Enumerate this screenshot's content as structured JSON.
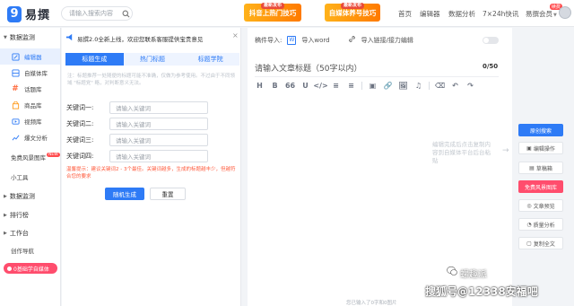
{
  "app": {
    "logo_mark": "9",
    "logo_text": "易撰"
  },
  "header": {
    "search_placeholder": "请输入搜索内容",
    "promo1": {
      "tag": "最新发布",
      "label": "抖音上热门技巧"
    },
    "promo2": {
      "tag": "最新发布",
      "label": "自媒体养号技巧"
    },
    "nav": [
      "首页",
      "编辑器",
      "数据分析",
      "7×24h快讯",
      "易撰会员"
    ],
    "nav_dropdown_marker": "▼",
    "nav_badge": "续费"
  },
  "sidebar": {
    "group_data_monitor": "数据监测",
    "items": [
      {
        "label": "编辑器",
        "icon": "edit-icon",
        "active": true
      },
      {
        "label": "自媒体库",
        "icon": "media-library-icon"
      },
      {
        "label": "话题库",
        "icon": "hashtag-icon"
      },
      {
        "label": "商品库",
        "icon": "shop-icon"
      },
      {
        "label": "视频库",
        "icon": "video-icon"
      },
      {
        "label": "爆文分析",
        "icon": "chart-icon"
      }
    ],
    "free_images": "免费风景图库",
    "free_badge": "NEW",
    "tools": "小工具",
    "group_monitor": "数据监测",
    "group_rank": "排行榜",
    "group_workbench": "工作台",
    "creator_nav": "创作导航",
    "pill": "0基础学自媒体"
  },
  "panel": {
    "notice": "易撰2.0全新上线，欢迎您联系客服提供宝贵意见",
    "notice_close": "×",
    "tabs": [
      "标题生成",
      "热门标题",
      "标题学院"
    ],
    "hint": "注：标题推荐一处随便的标题可能不准确，仅做为参考使用。不过由于不同领域 \"标题党\" 略，对判断意义无法。",
    "keywords": [
      {
        "label": "关键词一:",
        "placeholder": "请输入关键词"
      },
      {
        "label": "关键词二:",
        "placeholder": "请输入关键词"
      },
      {
        "label": "关键词三:",
        "placeholder": "请输入关键词"
      },
      {
        "label": "关键词四:",
        "placeholder": "请输入关键词"
      }
    ],
    "warning": "温馨提示：建议关键词2 - 3个最佳。关键词越多，生成的标题越丰少，但越符合您的要求",
    "generate_button": "随机生成",
    "reset_button": "重置"
  },
  "editor": {
    "draft_label": "稿件导入:",
    "import_word": "导入word",
    "import_link": "导入链接/接力编辑",
    "title_placeholder": "请输入文章标题（50字以内）",
    "counter": "0/50",
    "toolbar": [
      "H",
      "B",
      "66",
      "U",
      "</>",
      "≡",
      "≡",
      "▣",
      "🔗",
      "🖼",
      "♫",
      "⌫",
      "↶",
      "↷"
    ],
    "side_hint": "编辑完成后点击复制内容到自媒体平台后台粘贴",
    "side_arrow": "→",
    "footer_count": "您已输入了0字和0图片"
  },
  "actions": [
    {
      "label": "原创搜索",
      "style": "blue",
      "icon": ""
    },
    {
      "label": "编辑操作",
      "style": "default",
      "icon": "▣"
    },
    {
      "label": "草稿箱",
      "style": "default",
      "icon": "▤"
    },
    {
      "label": "免费风景图库",
      "style": "red",
      "icon": ""
    },
    {
      "label": "文章预览",
      "style": "default",
      "icon": "◎"
    },
    {
      "label": "质量分析",
      "style": "default",
      "icon": "◔"
    },
    {
      "label": "复制全文",
      "style": "default",
      "icon": "▢"
    }
  ],
  "watermark": {
    "line1": "螺趣派",
    "line2": "搜狐号@12338安福吧"
  }
}
